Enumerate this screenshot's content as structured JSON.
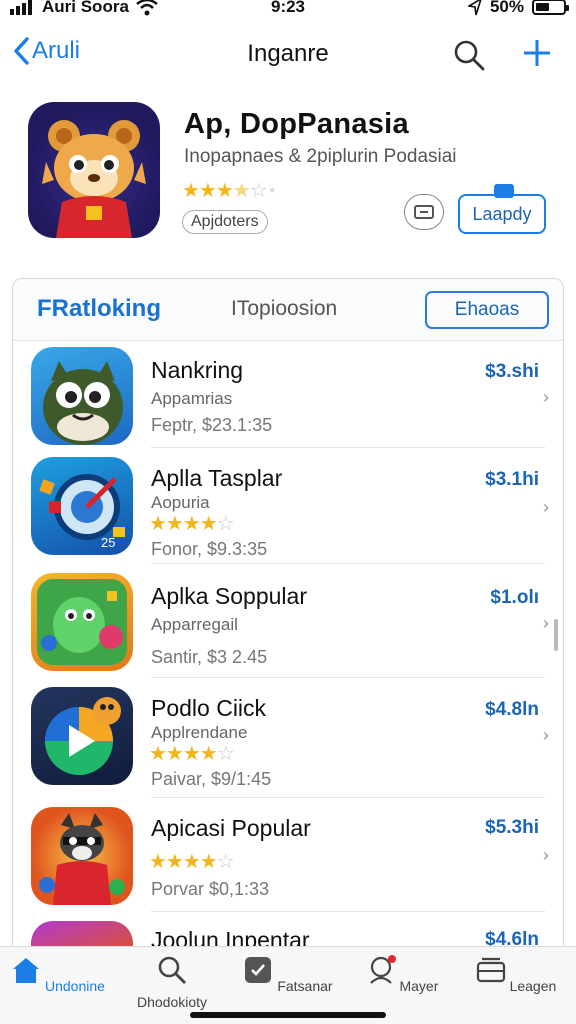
{
  "status": {
    "carrier": "Auri Soora",
    "time": "9:23",
    "battery": "50%",
    "battery_level": 0.5
  },
  "nav": {
    "back_label": "Aruli",
    "title": "Inganre"
  },
  "featured": {
    "title": "Ap, DopPanasia",
    "subtitle": "Inopapnaes & 2piplurin Podasiai",
    "rating": 3.5,
    "badge": "Apjdoters",
    "button_label": "Laapdy"
  },
  "tabs": {
    "ranking": "FRatloking",
    "top": "ITopioosion",
    "button": "Ehaoas"
  },
  "apps": [
    {
      "name": "Nankring",
      "category": "Appamrias",
      "meta": "Feptr, $23.1:35",
      "price": "$3.shi",
      "rating": null
    },
    {
      "name": "Aplla Tasplar",
      "category": "Aopuria",
      "meta": "Fonor, $9.3:35",
      "price": "$3.1hi",
      "rating": 4
    },
    {
      "name": "Aplka Soppular",
      "category": "Apparregail",
      "meta": "Santir, $3 2.45",
      "price": "$1.olı",
      "rating": null
    },
    {
      "name": "Podlo Ciick",
      "category": "Applrendane",
      "meta": "Paivar, $9/1:45",
      "price": "$4.8ln",
      "rating": 4
    },
    {
      "name": "Apicasi Popular",
      "category": "",
      "meta": "Porvar $0,1:33",
      "price": "$5.3hi",
      "rating": 4
    },
    {
      "name": "Joolun Inpentar",
      "category": "",
      "meta": "",
      "price": "$4.6ln",
      "rating": null
    }
  ],
  "tabbar": [
    {
      "label": "Undonine",
      "icon": "home-icon"
    },
    {
      "label": "Dhodokioty",
      "icon": "search-icon"
    },
    {
      "label": "Fatsanar",
      "icon": "apps-icon"
    },
    {
      "label": "Mayer",
      "icon": "profile-icon"
    },
    {
      "label": "Leagen",
      "icon": "library-icon"
    }
  ],
  "colors": {
    "accent": "#1a7ee6",
    "star": "#f2b51c"
  }
}
